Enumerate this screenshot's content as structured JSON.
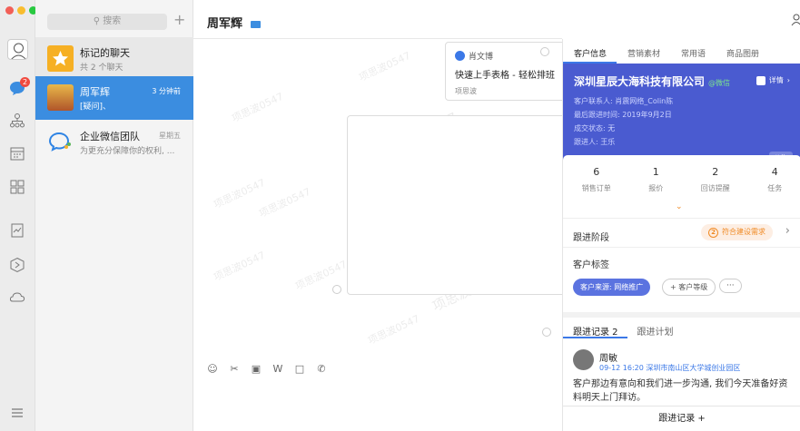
{
  "search": {
    "placeholder": "搜索"
  },
  "badges": {
    "messages": "2"
  },
  "conversations": [
    {
      "name": "标记的聊天",
      "sub": "共 2 个聊天",
      "time": ""
    },
    {
      "name": "周军辉",
      "sub": "[疑问]、",
      "time": "3 分钟前"
    },
    {
      "name": "企业微信团队",
      "sub": "为更充分保障你的权利, ...",
      "time": "星期五"
    }
  ],
  "chat": {
    "title": "周军辉",
    "card": {
      "from": "肖文博",
      "title": "快速上手表格 - 轻松排班",
      "source": "项思波"
    },
    "watermark": "项思波0547"
  },
  "panel": {
    "tabs": [
      "客户信息",
      "营销素材",
      "常用语",
      "商品图册"
    ],
    "company": {
      "name": "深圳星辰大海科技有限公司",
      "verified": "@微信",
      "detail": "详情",
      "rows": [
        "客户联系人: 肖震网络_Colin陈",
        "最后跟进时间: 2019年9月2日",
        "成交状态: 无",
        "跟进人: 王乐"
      ],
      "pub": "公海"
    },
    "stats": [
      {
        "n": "6",
        "l": "销售订单"
      },
      {
        "n": "1",
        "l": "报价"
      },
      {
        "n": "2",
        "l": "回访提醒"
      },
      {
        "n": "4",
        "l": "任务"
      }
    ],
    "stage_label": "跟进阶段",
    "stage_num": "2",
    "stage_value": "符合建设需求",
    "tags_label": "客户标签",
    "tag_source": "客户来源: 网络推广",
    "tag_add": "+ 客户等级",
    "tag_more": "···",
    "follow_tabs": [
      "跟进记录 2",
      "跟进计划"
    ],
    "record": {
      "name": "周敏",
      "meta": "09-12 16:20 深圳市南山区大学城创业园区",
      "text": "客户那边有意向和我们进一步沟通, 我们今天准备好资料明天上门拜访。"
    },
    "add_record": "跟进记录 +"
  }
}
